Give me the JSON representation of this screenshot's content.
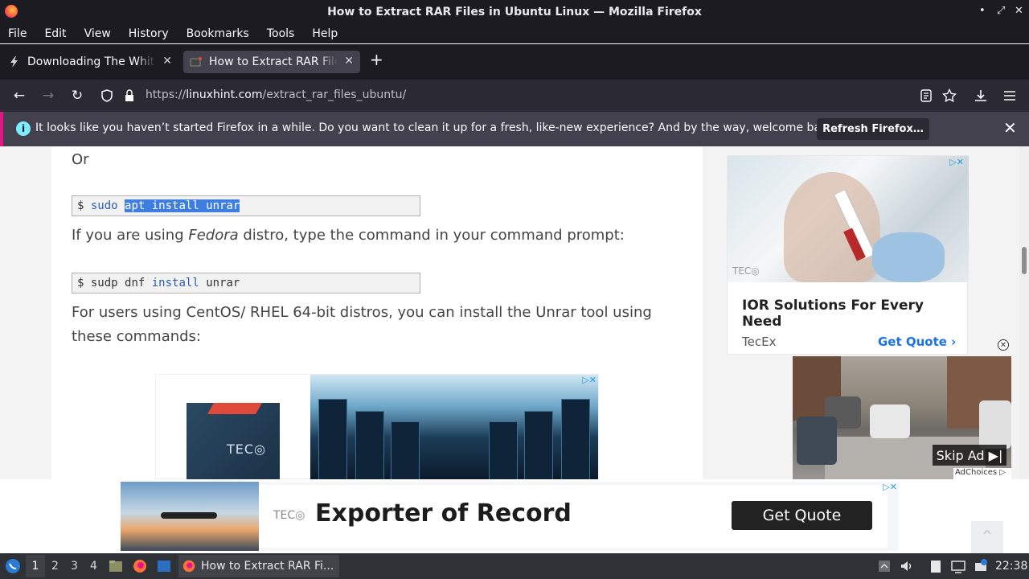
{
  "window": {
    "title": "How to Extract RAR Files in Ubuntu Linux — Mozilla Firefox",
    "controls": [
      "•",
      "⤢",
      "✕"
    ]
  },
  "menu": [
    "File",
    "Edit",
    "View",
    "History",
    "Bookmarks",
    "Tools",
    "Help"
  ],
  "tabs": [
    {
      "label": "Downloading The White Ha",
      "active": false
    },
    {
      "label": "How to Extract RAR Files",
      "active": true
    }
  ],
  "new_tab_label": "+",
  "address": {
    "prefix": "https://",
    "domain": "linuxhint.com",
    "path": "/extract_rar_files_ubuntu/"
  },
  "notification": {
    "message": "It looks like you haven’t started Firefox in a while. Do you want to clean it up for a fresh, like-new experience? And by the way, welcome back!",
    "button": "Refresh Firefox…",
    "close": "✕"
  },
  "article": {
    "or_text": "Or",
    "code1": {
      "prompt": "$",
      "pre": "sudo",
      "selected": "apt install unrar"
    },
    "fedora_pre": "If you are using ",
    "fedora_em": "Fedora",
    "fedora_post": " distro, type the command in your command prompt:",
    "code2": {
      "prompt": "$",
      "cmd": "sudp dnf",
      "kw": "install",
      "arg": "unrar"
    },
    "centos_text": "For users using CentOS/ RHEL 64-bit distros, you can install the Unrar tool using these commands:"
  },
  "inline_ad": {
    "brand_mark": "TEC◎",
    "ad_x": "▷✕"
  },
  "side_ad": {
    "brand_mark": "TEC◎",
    "headline": "IOR Solutions For Every Need",
    "brand": "TecEx",
    "cta": "Get Quote ›",
    "ad_x": "▷✕"
  },
  "video_ad": {
    "skip": "Skip Ad ▶|",
    "adchoices": "AdChoices ▷",
    "close": "✕"
  },
  "bottom_ad": {
    "brand_mark": "TEC◎",
    "headline": "Exporter of Record",
    "cta": "Get Quote",
    "ad_x": "▷✕",
    "to_top": "⌃"
  },
  "taskbar": {
    "workspaces": [
      "1",
      "2",
      "3",
      "4"
    ],
    "window_title": "How to Extract RAR Fi...",
    "clock": "22:38"
  }
}
